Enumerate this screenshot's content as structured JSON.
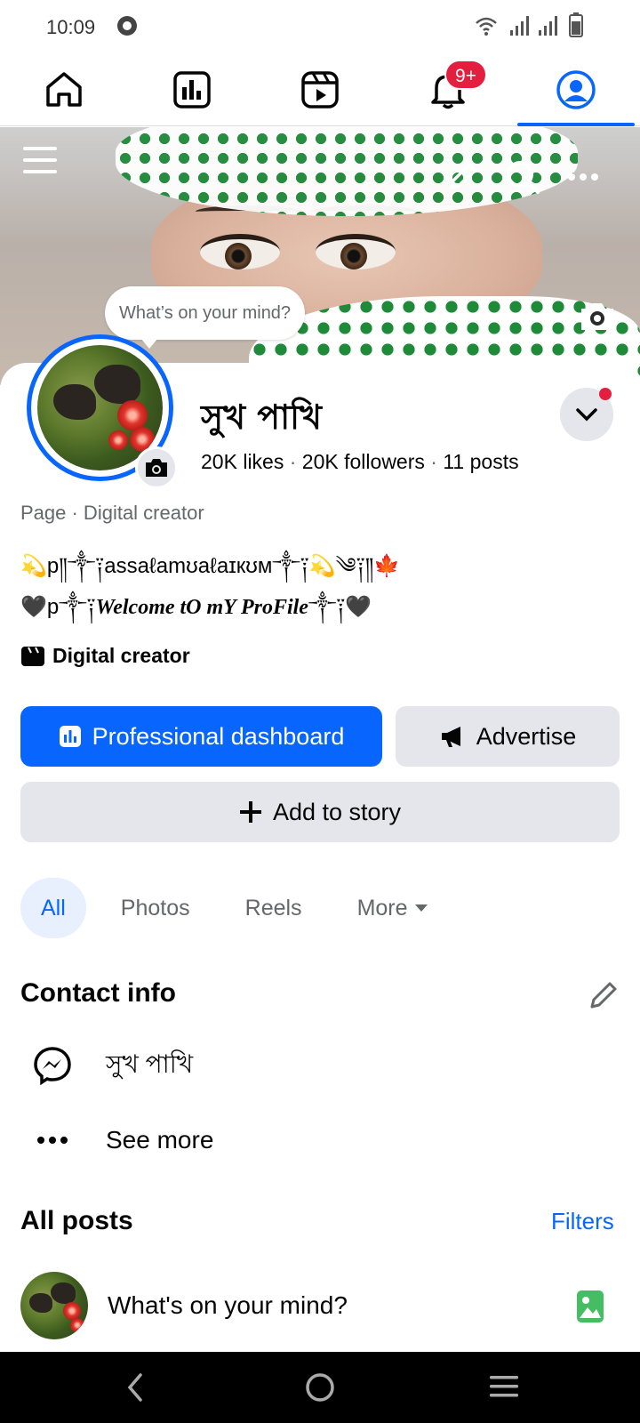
{
  "status_bar": {
    "time": "10:09"
  },
  "top_nav": {
    "items": [
      "home",
      "dashboard",
      "reels",
      "notifications",
      "profile"
    ],
    "notification_badge": "9+",
    "active": "profile"
  },
  "cover": {
    "mind_bubble": "What’s on your mind?"
  },
  "profile": {
    "name": "সুখ পাখি",
    "likes_count": "20K",
    "likes_label": "likes",
    "followers_count": "20K",
    "followers_label": "followers",
    "posts_count": "11",
    "posts_label": "posts",
    "separator": "·",
    "page_category": "Page · Digital creator",
    "bio_line1": "💫p༎༒༑assaℓamʊaℓaɪкʊм༒༑💫༄༑༎🍁",
    "bio_line2_prefix": "🖤p༒༑",
    "bio_line2_styled": "Welcome tO mY ProFile",
    "bio_line2_suffix": "༒༑🖤",
    "category_tag": "Digital creator"
  },
  "actions": {
    "dashboard_label": "Professional dashboard",
    "advertise_label": "Advertise",
    "add_story_label": "Add to story"
  },
  "tabs": [
    {
      "label": "All",
      "active": true
    },
    {
      "label": "Photos",
      "active": false
    },
    {
      "label": "Reels",
      "active": false
    },
    {
      "label": "More",
      "active": false
    }
  ],
  "contact_info": {
    "title": "Contact info",
    "messenger": "সুখ পাখি",
    "see_more": "See more"
  },
  "posts": {
    "title": "All posts",
    "filters_label": "Filters",
    "composer_placeholder": "What's on your mind?"
  },
  "colors": {
    "accent": "#0866ff",
    "badge": "#e41e3f",
    "gray_button": "#e4e6eb",
    "photo_icon": "#45bd62"
  }
}
